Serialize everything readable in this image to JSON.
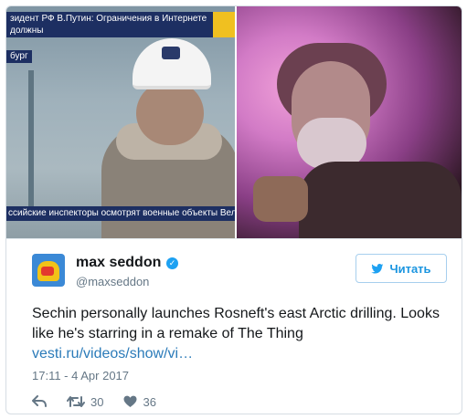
{
  "media": {
    "left_image": {
      "ticker_top": "зидент РФ В.Путин: Ограничения в Интернете должны\nответствовать уровню развития общества",
      "ticker_city": "бург",
      "ticker_bottom": "ссийские инспекторы осмотрят военные объекты Великобр"
    }
  },
  "tweet": {
    "author_name": "max seddon",
    "author_handle": "@maxseddon",
    "follow_label": "Читать",
    "text": "Sechin personally launches Rosneft's east Arctic drilling. Looks like he's starring in a remake of The Thing",
    "link": "vesti.ru/videos/show/vi…",
    "timestamp": "17:11 - 4 Apr 2017",
    "retweets": "30",
    "likes": "36"
  },
  "colors": {
    "accent": "#1da1f2",
    "link": "#2b7bb9",
    "muted": "#657786",
    "border": "#d6dde3"
  },
  "icons": [
    "verified-icon",
    "twitter-bird-icon",
    "reply-icon",
    "retweet-icon",
    "like-icon"
  ]
}
